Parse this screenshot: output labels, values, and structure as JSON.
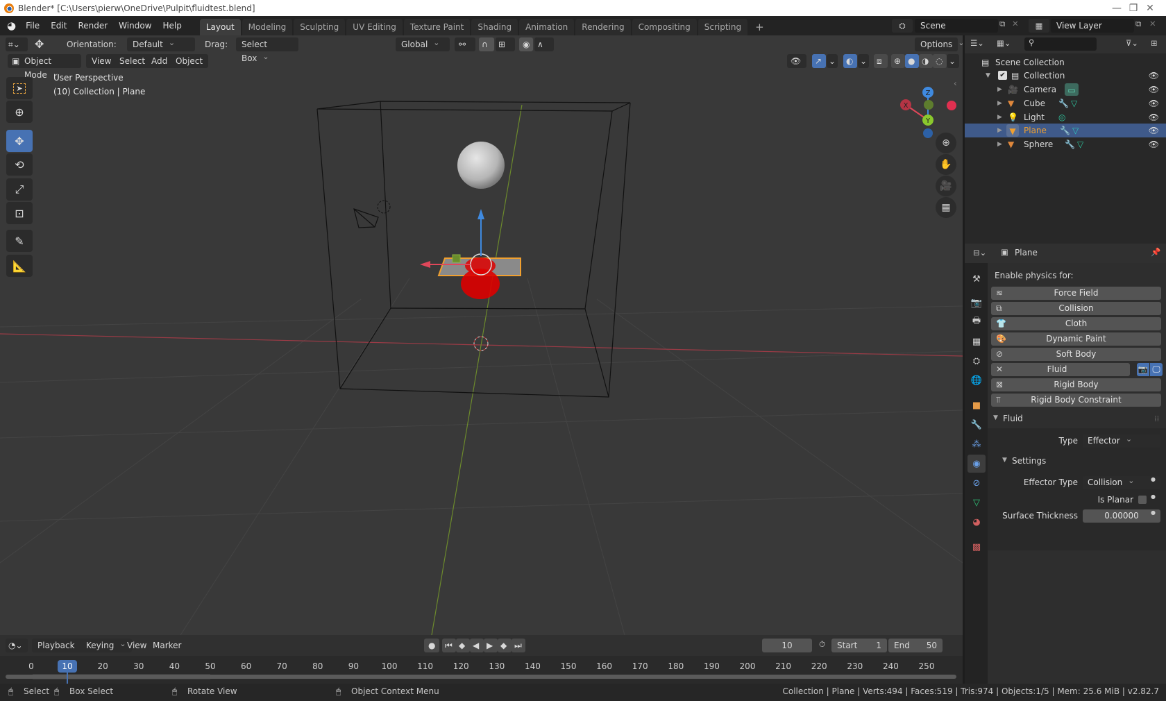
{
  "window": {
    "title": "Blender* [C:\\Users\\pierw\\OneDrive\\Pulpit\\fluidtest.blend]",
    "controls": [
      "minimize",
      "maximize",
      "close"
    ]
  },
  "menu": [
    "File",
    "Edit",
    "Render",
    "Window",
    "Help"
  ],
  "workspaces": {
    "tabs": [
      "Layout",
      "Modeling",
      "Sculpting",
      "UV Editing",
      "Texture Paint",
      "Shading",
      "Animation",
      "Rendering",
      "Compositing",
      "Scripting"
    ],
    "active": "Layout",
    "add_label": "+"
  },
  "scene": {
    "name": "Scene",
    "view_layer": "View Layer"
  },
  "tool_header": {
    "orientation_label": "Orientation:",
    "orientation_value": "Default",
    "drag_label": "Drag:",
    "drag_value": "Select Box",
    "transform_orientation": "Global",
    "options_label": "Options"
  },
  "viewport_header": {
    "mode": "Object Mode",
    "menus": [
      "View",
      "Select",
      "Add",
      "Object"
    ]
  },
  "viewport": {
    "overlay_line1": "User Perspective",
    "overlay_line2": "(10) Collection | Plane",
    "gizmo_axes": {
      "x": "X",
      "y": "Y",
      "z": "Z"
    },
    "colors": {
      "x_axis": "#e0475a",
      "y_axis": "#8ac82d",
      "z_axis": "#3f8ae0",
      "selected_outline": "#f0a030",
      "particles": "#e00000"
    }
  },
  "toolbar": {
    "tools": [
      "select-box",
      "cursor",
      "move",
      "rotate",
      "scale",
      "transform",
      "annotate",
      "measure"
    ],
    "active": "move"
  },
  "outliner": {
    "root": "Scene Collection",
    "collection": "Collection",
    "items": [
      {
        "name": "Camera",
        "type": "camera",
        "selected": false
      },
      {
        "name": "Cube",
        "type": "mesh",
        "selected": false
      },
      {
        "name": "Light",
        "type": "light",
        "selected": false
      },
      {
        "name": "Plane",
        "type": "mesh",
        "selected": true
      },
      {
        "name": "Sphere",
        "type": "mesh",
        "selected": false
      }
    ]
  },
  "properties": {
    "object_name": "Plane",
    "enable_physics_label": "Enable physics for:",
    "physics_buttons": [
      "Force Field",
      "Collision",
      "Cloth",
      "Dynamic Paint",
      "Soft Body",
      "Fluid",
      "Rigid Body",
      "Rigid Body Constraint"
    ],
    "fluid_panel": {
      "title": "Fluid",
      "type_label": "Type",
      "type_value": "Effector",
      "settings_title": "Settings",
      "effector_type_label": "Effector Type",
      "effector_type_value": "Collision",
      "is_planar_label": "Is Planar",
      "is_planar": false,
      "surface_thickness_label": "Surface Thickness",
      "surface_thickness_value": "0.00000"
    }
  },
  "timeline": {
    "menus": [
      "Playback",
      "Keying",
      "View",
      "Marker"
    ],
    "current_frame": "10",
    "start_label": "Start",
    "start_value": "1",
    "end_label": "End",
    "end_value": "50",
    "ticks": [
      "0",
      "10",
      "20",
      "30",
      "40",
      "50",
      "60",
      "70",
      "80",
      "90",
      "100",
      "110",
      "120",
      "130",
      "140",
      "150",
      "160",
      "170",
      "180",
      "190",
      "200",
      "210",
      "220",
      "230",
      "240",
      "250"
    ]
  },
  "statusbar": {
    "hints": [
      "Select",
      "Box Select",
      "Rotate View",
      "Object Context Menu"
    ],
    "stats": "Collection | Plane | Verts:494 | Faces:519 | Tris:974 | Objects:1/5 | Mem: 25.6 MiB | v2.82.7"
  }
}
